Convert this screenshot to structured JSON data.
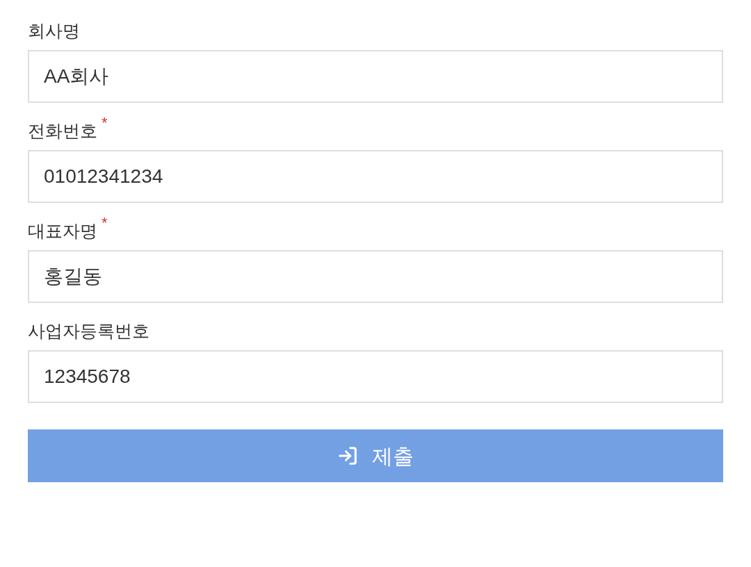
{
  "fields": [
    {
      "label": "회사명",
      "value": "AA회사"
    },
    {
      "label": "전화번호",
      "required_mark": "*",
      "value": "01012341234"
    },
    {
      "label": "대표자명",
      "required_mark": "*",
      "value": "홍길동"
    },
    {
      "label": "사업자등록번호",
      "value": "12345678"
    }
  ],
  "submit_button": {
    "label": "제출"
  }
}
